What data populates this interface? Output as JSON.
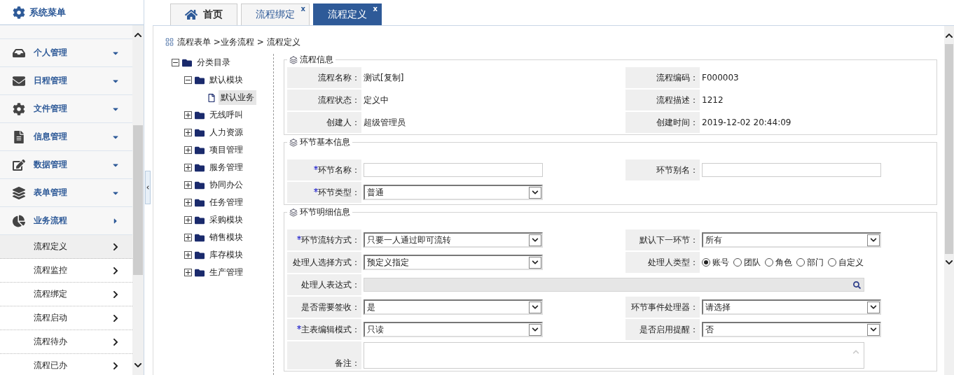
{
  "sidebar": {
    "title": "系统菜单",
    "items": [
      {
        "label": "个人管理",
        "expanded": false
      },
      {
        "label": "日程管理",
        "expanded": false
      },
      {
        "label": "文件管理",
        "expanded": false
      },
      {
        "label": "信息管理",
        "expanded": false
      },
      {
        "label": "数据管理",
        "expanded": false
      },
      {
        "label": "表单管理",
        "expanded": false
      },
      {
        "label": "业务流程",
        "expanded": true,
        "children": [
          {
            "label": "流程定义",
            "selected": true
          },
          {
            "label": "流程监控",
            "selected": false
          },
          {
            "label": "流程绑定",
            "selected": false
          },
          {
            "label": "流程启动",
            "selected": false
          },
          {
            "label": "流程待办",
            "selected": false
          },
          {
            "label": "流程已办",
            "selected": false
          }
        ]
      }
    ]
  },
  "tabs": [
    {
      "label": "首页",
      "kind": "home",
      "selected": false
    },
    {
      "label": "流程绑定",
      "kind": "page",
      "selected": false,
      "close": "x"
    },
    {
      "label": "流程定义",
      "kind": "page",
      "selected": true,
      "close": "x"
    }
  ],
  "breadcrumb": "流程表单 >业务流程 > 流程定义",
  "tree": {
    "label": "分类目录",
    "kind": "folder",
    "expanded": true,
    "children": [
      {
        "label": "默认模块",
        "kind": "folder",
        "expanded": true,
        "children": [
          {
            "label": "默认业务",
            "kind": "file",
            "selected": true
          }
        ]
      },
      {
        "label": "无线呼叫",
        "kind": "folder",
        "expanded": false
      },
      {
        "label": "人力资源",
        "kind": "folder",
        "expanded": false
      },
      {
        "label": "项目管理",
        "kind": "folder",
        "expanded": false
      },
      {
        "label": "服务管理",
        "kind": "folder",
        "expanded": false
      },
      {
        "label": "协同办公",
        "kind": "folder",
        "expanded": false
      },
      {
        "label": "任务管理",
        "kind": "folder",
        "expanded": false
      },
      {
        "label": "采购模块",
        "kind": "folder",
        "expanded": false
      },
      {
        "label": "销售模块",
        "kind": "folder",
        "expanded": false
      },
      {
        "label": "库存模块",
        "kind": "folder",
        "expanded": false
      },
      {
        "label": "生产管理",
        "kind": "folder",
        "expanded": false
      }
    ]
  },
  "sections": [
    {
      "title": "流程信息",
      "rows": [
        [
          {
            "label": "流程名称：",
            "kind": "text",
            "value": "测试[复制]"
          },
          {
            "label": "流程编码：",
            "kind": "text",
            "value": "F000003"
          }
        ],
        [
          {
            "label": "流程状态：",
            "kind": "text",
            "value": "定义中"
          },
          {
            "label": "流程描述：",
            "kind": "text",
            "value": "1212"
          }
        ],
        [
          {
            "label": "创建人：",
            "kind": "text",
            "value": "超级管理员"
          },
          {
            "label": "创建时间：",
            "kind": "text",
            "value": "2019-12-02 20:44:09"
          }
        ]
      ]
    },
    {
      "title": "环节基本信息",
      "rows": [
        [
          {
            "label": "环节名称：",
            "required": true,
            "kind": "input"
          },
          {
            "label": "环节别名：",
            "required": false,
            "kind": "input"
          }
        ],
        [
          {
            "label": "环节类型：",
            "required": true,
            "kind": "select",
            "value": "普通"
          }
        ]
      ]
    },
    {
      "title": "环节明细信息",
      "rows": [
        [
          {
            "label": "环节流转方式：",
            "required": true,
            "kind": "select",
            "value": "只要一人通过即可流转"
          },
          {
            "label": "默认下一环节：",
            "required": false,
            "kind": "select",
            "value": "所有"
          }
        ],
        [
          {
            "label": "处理人选择方式：",
            "required": false,
            "kind": "select",
            "value": "预定义指定"
          },
          {
            "label": "处理人类型：",
            "required": false,
            "kind": "radio",
            "options": [
              {
                "label": "账号",
                "selected": true
              },
              {
                "label": "团队",
                "selected": false
              },
              {
                "label": "角色",
                "selected": false
              },
              {
                "label": "部门",
                "selected": false
              },
              {
                "label": "自定义",
                "selected": false
              }
            ]
          }
        ],
        [
          {
            "label": "处理人表达式：",
            "required": false,
            "kind": "search",
            "disabled": true
          }
        ],
        [
          {
            "label": "是否需要签收：",
            "required": false,
            "kind": "select",
            "value": "是"
          },
          {
            "label": "环节事件处理器：",
            "required": false,
            "kind": "select",
            "value": "请选择"
          }
        ],
        [
          {
            "label": "主表编辑模式：",
            "required": true,
            "kind": "select",
            "value": "只读"
          },
          {
            "label": "是否启用提醒：",
            "required": false,
            "kind": "select",
            "value": "否"
          }
        ],
        [
          {
            "label": "备注：",
            "required": false,
            "kind": "textarea"
          }
        ]
      ]
    }
  ]
}
